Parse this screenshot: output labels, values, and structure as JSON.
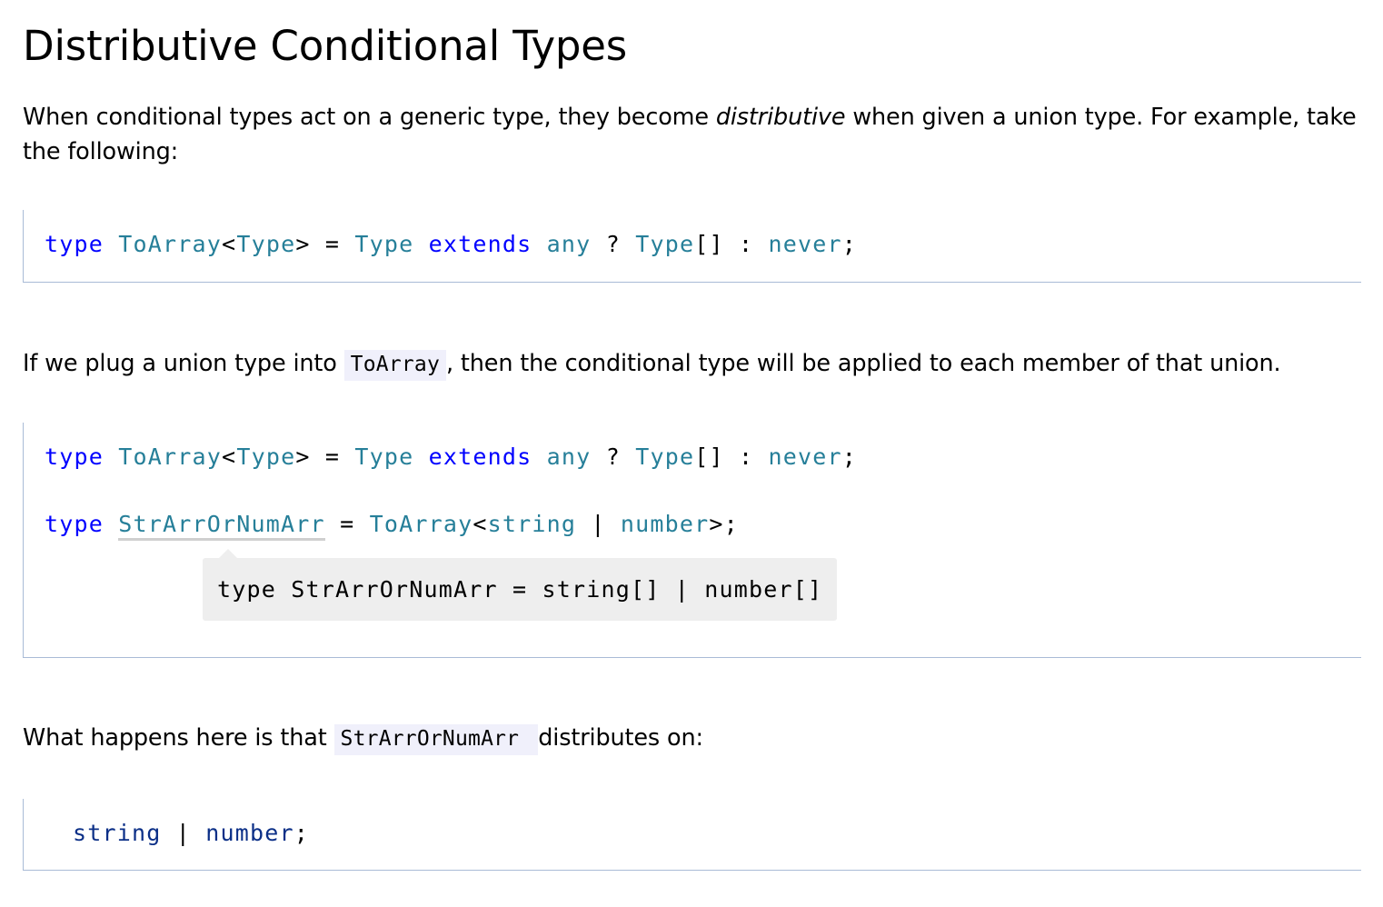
{
  "heading": "Distributive Conditional Types",
  "intro": {
    "before": "When conditional types act on a generic type, they become ",
    "emphasis": "distributive",
    "after": " when given a union type. For example, take the following:"
  },
  "snippet1": {
    "t_type": "type",
    "t_name": "ToArray",
    "t_lt": "<",
    "t_param": "Type",
    "t_gt": ">",
    "t_eq": " = ",
    "t_type2": "Type",
    "t_extends": "extends",
    "t_any": "any",
    "t_q": " ? ",
    "t_type3": "Type",
    "t_arr": "[] : ",
    "t_never": "never",
    "t_semi": ";"
  },
  "para2": {
    "before": "If we plug a union type into ",
    "code": "ToArray",
    "after": ", then the conditional type will be applied to each member of that union."
  },
  "snippet2": {
    "line1": {
      "t_type": "type",
      "t_name": "ToArray",
      "t_lt": "<",
      "t_param": "Type",
      "t_gt": ">",
      "t_eq": " = ",
      "t_type2": "Type",
      "t_extends": "extends",
      "t_any": "any",
      "t_q": " ? ",
      "t_type3": "Type",
      "t_arr": "[] : ",
      "t_never": "never",
      "t_semi": ";"
    },
    "line2": {
      "t_type": "type",
      "t_name": "StrArrOrNumArr",
      "t_eq": " = ",
      "t_to": "ToArray",
      "t_lt": "<",
      "t_string": "string",
      "t_pipe": " | ",
      "t_number": "number",
      "t_end": ">;"
    },
    "tooltip": "type StrArrOrNumArr = string[] | number[]"
  },
  "para3": {
    "before": "What happens here is that ",
    "code": "StrArrOrNumArr ",
    "after": "distributes on:"
  },
  "snippet3": {
    "t_string": "string",
    "t_pipe": " | ",
    "t_number": "number",
    "t_semi": ";"
  }
}
